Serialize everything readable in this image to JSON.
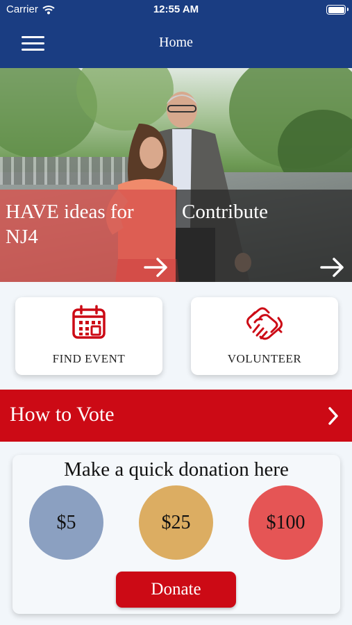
{
  "status_bar": {
    "carrier": "Carrier",
    "time": "12:55 AM"
  },
  "nav": {
    "title": "Home",
    "menu_icon": "hamburger-menu-icon"
  },
  "hero": {
    "tiles": [
      {
        "label": "HAVE ideas for NJ4",
        "icon": "arrow-right-icon"
      },
      {
        "label": "Contribute",
        "icon": "arrow-right-icon"
      }
    ]
  },
  "actions": {
    "find_event": {
      "label": "FIND EVENT",
      "icon": "calendar-icon"
    },
    "volunteer": {
      "label": "VOLUNTEER",
      "icon": "handshake-icon"
    }
  },
  "vote": {
    "label": "How to Vote",
    "icon": "chevron-right-icon"
  },
  "donation": {
    "heading": "Make a quick donation here",
    "amounts": [
      "$5",
      "$25",
      "$100"
    ],
    "button": "Donate"
  },
  "colors": {
    "nav_blue": "#1a3d82",
    "accent_red": "#cc0a15",
    "amount_5": "#8ba0c1",
    "amount_25": "#dcad62",
    "amount_100": "#e55555"
  }
}
